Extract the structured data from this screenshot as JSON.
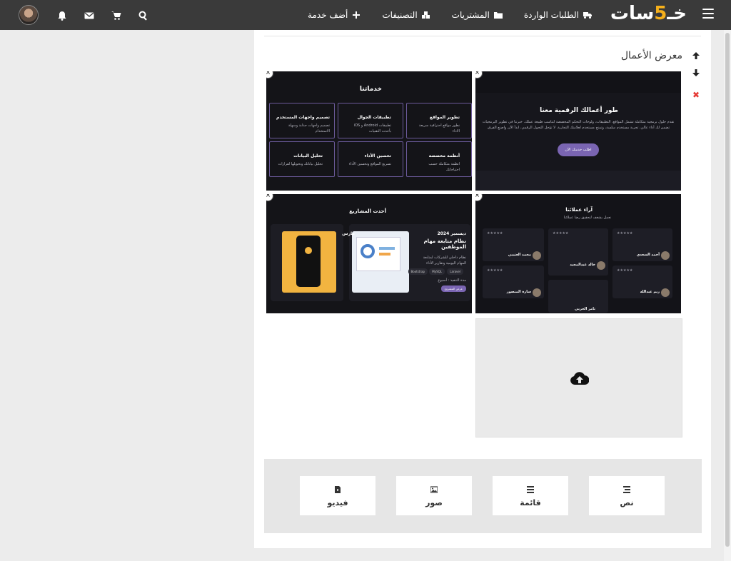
{
  "header": {
    "logo_main": "خـ",
    "logo_five": "5",
    "logo_rest": "سات",
    "nav": [
      {
        "label": "أضف خدمة",
        "icon": "plus-icon"
      },
      {
        "label": "التصنيفات",
        "icon": "cubes-icon"
      },
      {
        "label": "المشتريات",
        "icon": "folder-icon"
      },
      {
        "label": "الطلبات الواردة",
        "icon": "truck-icon"
      }
    ],
    "icons": [
      "search-icon",
      "cart-icon",
      "envelope-icon",
      "bell-icon"
    ]
  },
  "section": {
    "title": "معرض الأعمال",
    "remove": "✖"
  },
  "gallery": {
    "close": "×",
    "thumb1": {
      "title": "طور أعمالك الرقمية معنا",
      "text": "نقدم حلول برمجية متكاملة تشمل المواقع، التطبيقات، ولوحات التحكم المخصصة لتناسب طبيعة عملك. خبرتنا في تطوير البرمجيات تضمن لك أداء عالي، تجربة مستخدم سلسة، وتمنح مستخدم لعلامتك التجارية. لا تؤجل التحول الرقمي، ابدأ الآن واصنع الفرق.",
      "button": "اطلب خدمتك الآن"
    },
    "thumb2": {
      "title": "خدماتنا",
      "cards": [
        {
          "title": "تطوير المواقع",
          "text": "نطور مواقع احترافية سريعة الاداء"
        },
        {
          "title": "تطبيقات الجوال",
          "text": "تطبيقات Android و iOS بأحدث التقنيات"
        },
        {
          "title": "تصميم واجهات المستخدم",
          "text": "تصميم واجهات جذابة وسهلة الاستخدام"
        },
        {
          "title": "أنظمة مخصصة",
          "text": "انظمة متكاملة حسب احتياجاتك"
        },
        {
          "title": "تحسين الأداء",
          "text": "تسريع المواقع وتحسين الأداء"
        },
        {
          "title": "تحليل البيانات",
          "text": "تحليل بياناتك وتحويلها لقرارات"
        }
      ]
    },
    "thumb3": {
      "title": "آراء عملائنا",
      "subtitle": "نعمل بشغف لتحقيق رضا عملائنا",
      "stars": "★★★★★",
      "reviews": [
        {
          "name": "أحمد السعدي",
          "role": "مدير المشروع"
        },
        {
          "name": "خالد عبدالمجيد",
          "role": "مؤسس شركة"
        },
        {
          "name": "محمد العتيبي",
          "role": "مدير تقنية المعلومات"
        },
        {
          "name": "ريم عبدالله",
          "role": "مديرة تسويق"
        },
        {
          "name": "تامر الحربي",
          "role": ""
        },
        {
          "name": "سارة المنصور",
          "role": "مديرة العمليات"
        }
      ]
    },
    "thumb4": {
      "title": "أحدث المشاريع",
      "date": "ديسمبر 2024",
      "project": "نظام متابعة مهام الموظفين",
      "text": "نظام داخلي للشركات لمتابعة المهام اليومية وتقارير الأداء",
      "tags": [
        "Bootstrap",
        "MySQL",
        "Laravel"
      ],
      "duration": "مدة التنفيذ : أسبوع",
      "button": "عرض المشروع",
      "side": "مارس"
    }
  },
  "tools": [
    {
      "label": "نص",
      "icon": "text-icon"
    },
    {
      "label": "قائمة",
      "icon": "list-icon"
    },
    {
      "label": "صور",
      "icon": "image-icon"
    },
    {
      "label": "فيديو",
      "icon": "video-file-icon"
    }
  ]
}
